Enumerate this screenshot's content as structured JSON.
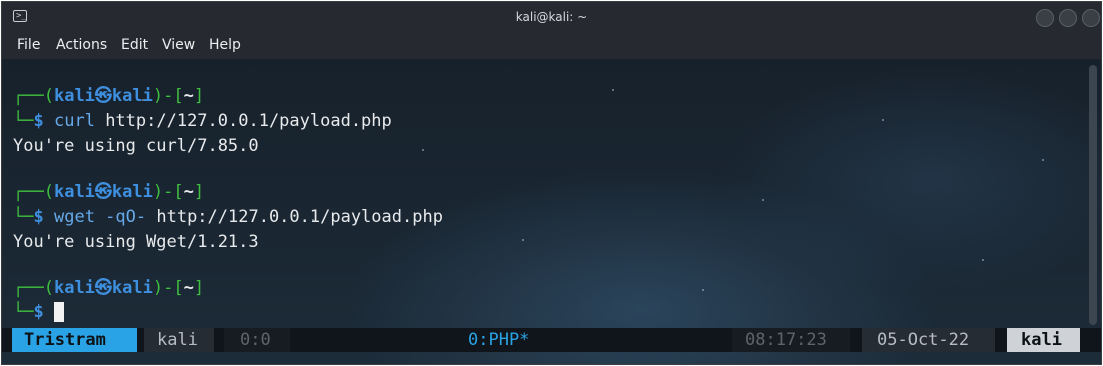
{
  "window": {
    "title": "kali@kali: ~"
  },
  "menu": [
    "File",
    "Actions",
    "Edit",
    "View",
    "Help"
  ],
  "prompt": {
    "corner_top": "┌──",
    "open": "(",
    "user": "kali",
    "at_symbol": "㉿",
    "host": "kali",
    "close": ")-[",
    "dir": "~",
    "end": "]",
    "corner_bottom": "└─",
    "dollar": "$"
  },
  "session": {
    "cmd1": "curl",
    "arg1": "http://127.0.0.1/payload.php",
    "out1": "You're using curl/7.85.0",
    "cmd2": "wget -qO-",
    "arg2": "http://127.0.0.1/payload.php",
    "out2": "You're using Wget/1.21.3"
  },
  "statusbar": {
    "session_name": "Tristram",
    "user": "kali",
    "pane": "0:0",
    "window": "0:PHP*",
    "time": "08:17:23",
    "date": "05-Oct-22",
    "host": "kali"
  },
  "colors": {
    "prompt_green": "#3fbf3f",
    "prompt_blue": "#3f8fdf",
    "status_highlight": "#2aa3e6"
  }
}
